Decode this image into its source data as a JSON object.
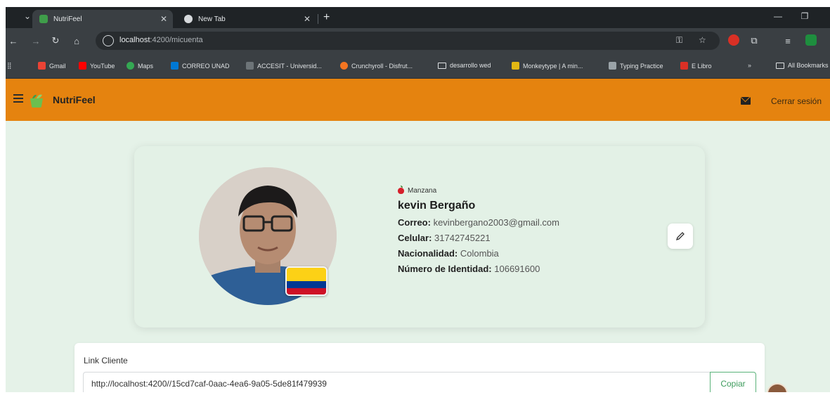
{
  "browser": {
    "tabs": [
      {
        "title": "NutriFeel",
        "favicon_color": "#3f9d4a",
        "active": true
      },
      {
        "title": "New Tab",
        "favicon_color": "#d6d9dc",
        "active": false
      }
    ],
    "url_host": "localhost",
    "url_path": ":4200/micuenta",
    "bookmarks": [
      {
        "label": "Gmail",
        "icon": "gmail-icon",
        "color": "#ea4335"
      },
      {
        "label": "YouTube",
        "icon": "youtube-icon",
        "color": "#ff0000"
      },
      {
        "label": "Maps",
        "icon": "maps-icon",
        "color": "#34a853"
      },
      {
        "label": "CORREO UNAD",
        "icon": "outlook-icon",
        "color": "#0078d4"
      },
      {
        "label": "ACCESIT - Universid...",
        "icon": "accesit-icon",
        "color": "#6d7478"
      },
      {
        "label": "Crunchyroll - Disfrut...",
        "icon": "crunchyroll-icon",
        "color": "#f47521"
      },
      {
        "label": "desarrollo wed",
        "icon": "folder-icon",
        "color": ""
      },
      {
        "label": "Monkeytype | A min...",
        "icon": "monkeytype-icon",
        "color": "#e2b714"
      },
      {
        "label": "Typing Practice",
        "icon": "typing-icon",
        "color": "#9aa3a8"
      },
      {
        "label": "E Libro",
        "icon": "elibro-icon",
        "color": "#d93025"
      },
      {
        "label": "All Bookmarks",
        "icon": "folder-icon",
        "color": ""
      }
    ]
  },
  "app": {
    "brand": "NutriFeel",
    "logout": "Cerrar sesión",
    "accent": "#e5830f",
    "background": "#e5f2e8"
  },
  "profile": {
    "fruit": "Manzana",
    "name": "kevin Bergaño",
    "fields": [
      {
        "label": "Correo:",
        "value": "kevinbergano2003@gmail.com"
      },
      {
        "label": "Celular:",
        "value": "31742745221"
      },
      {
        "label": "Nacionalidad:",
        "value": "Colombia"
      },
      {
        "label": "Número de Identidad:",
        "value": "106691600"
      }
    ],
    "flag_colors": [
      "#fcd116",
      "#003893",
      "#ce1126"
    ]
  },
  "client_link": {
    "label": "Link Cliente",
    "value": "http://localhost:4200//15cd7caf-0aac-4ea6-9a05-5de81f479939",
    "copy_label": "Copiar"
  }
}
